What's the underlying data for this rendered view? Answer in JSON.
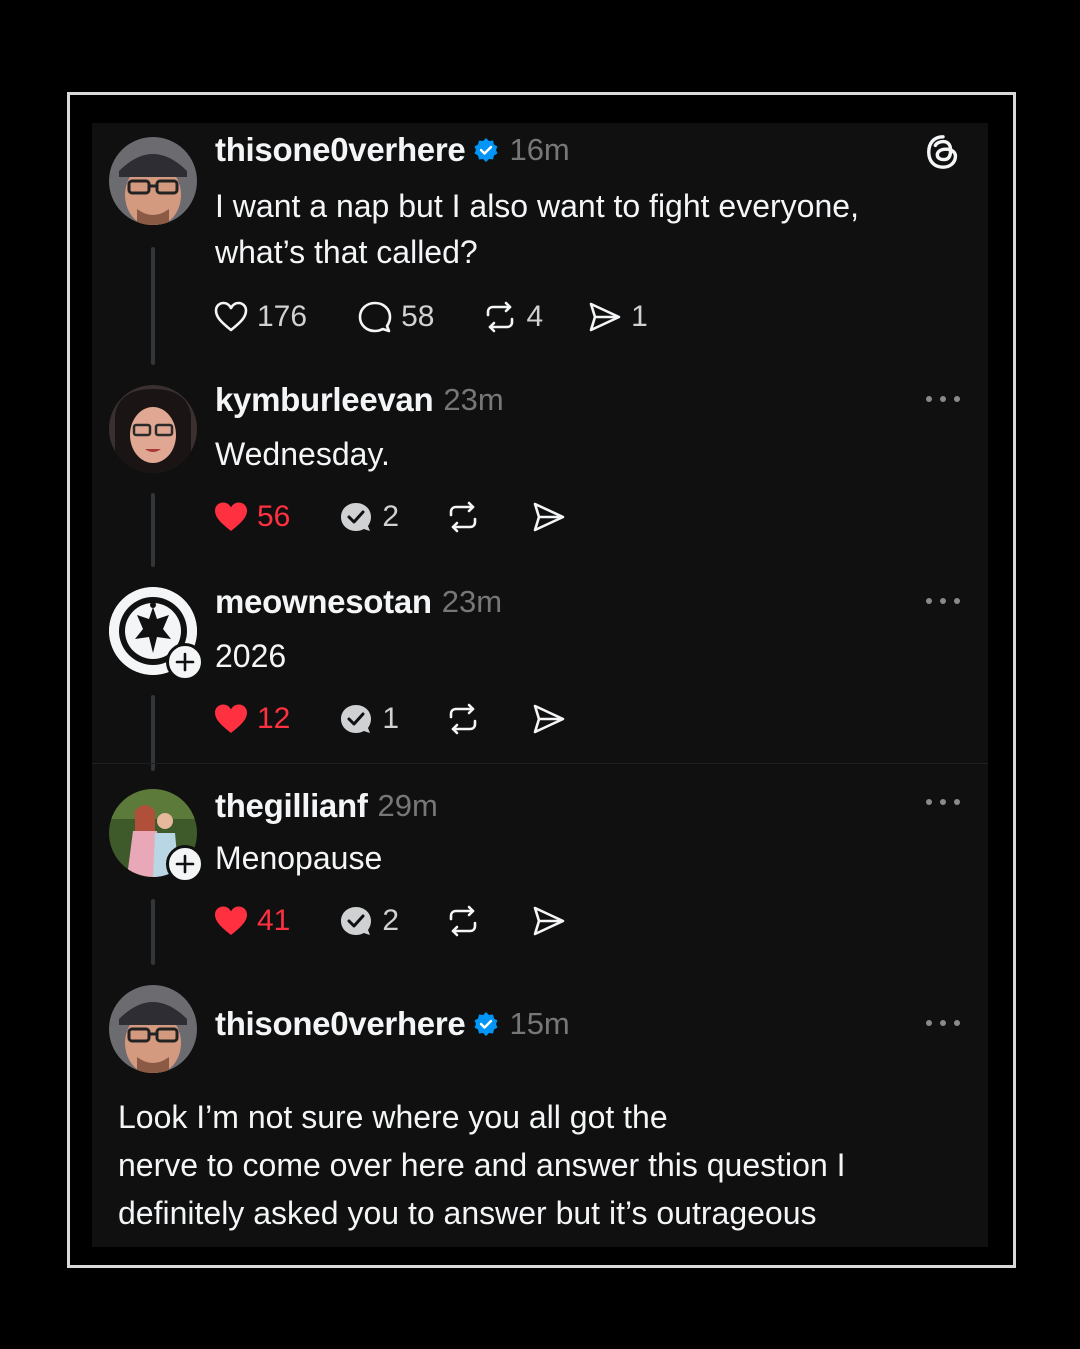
{
  "app": {
    "logo_icon": "threads-logo-icon"
  },
  "colors": {
    "background": "#000000",
    "card": "#101010",
    "like_active": "#ff3040",
    "verified": "#0095f6",
    "muted": "#777777"
  },
  "posts": [
    {
      "username": "thisone0verhere",
      "verified": true,
      "time": "16m",
      "text": "I want a nap but I also want to fight everyone, what’s that called?",
      "likes": "176",
      "replies": "58",
      "reposts": "4",
      "shares": "1",
      "liked": false
    },
    {
      "username": "kymburleevan",
      "verified": false,
      "time": "23m",
      "text": "Wednesday.",
      "likes": "56",
      "replies": "2",
      "liked": true
    },
    {
      "username": "meownesotan",
      "verified": false,
      "time": "23m",
      "text": "2026",
      "likes": "12",
      "replies": "1",
      "liked": true
    },
    {
      "username": "thegillianf",
      "verified": false,
      "time": "29m",
      "text": "Menopause",
      "likes": "41",
      "replies": "2",
      "liked": true
    },
    {
      "username": "thisone0verhere",
      "verified": true,
      "time": "15m",
      "text_lines": [
        "Look I’m not sure where you all got the",
        "nerve to come over here and answer this question I",
        "definitely asked you to answer but it’s outrageous"
      ]
    }
  ]
}
